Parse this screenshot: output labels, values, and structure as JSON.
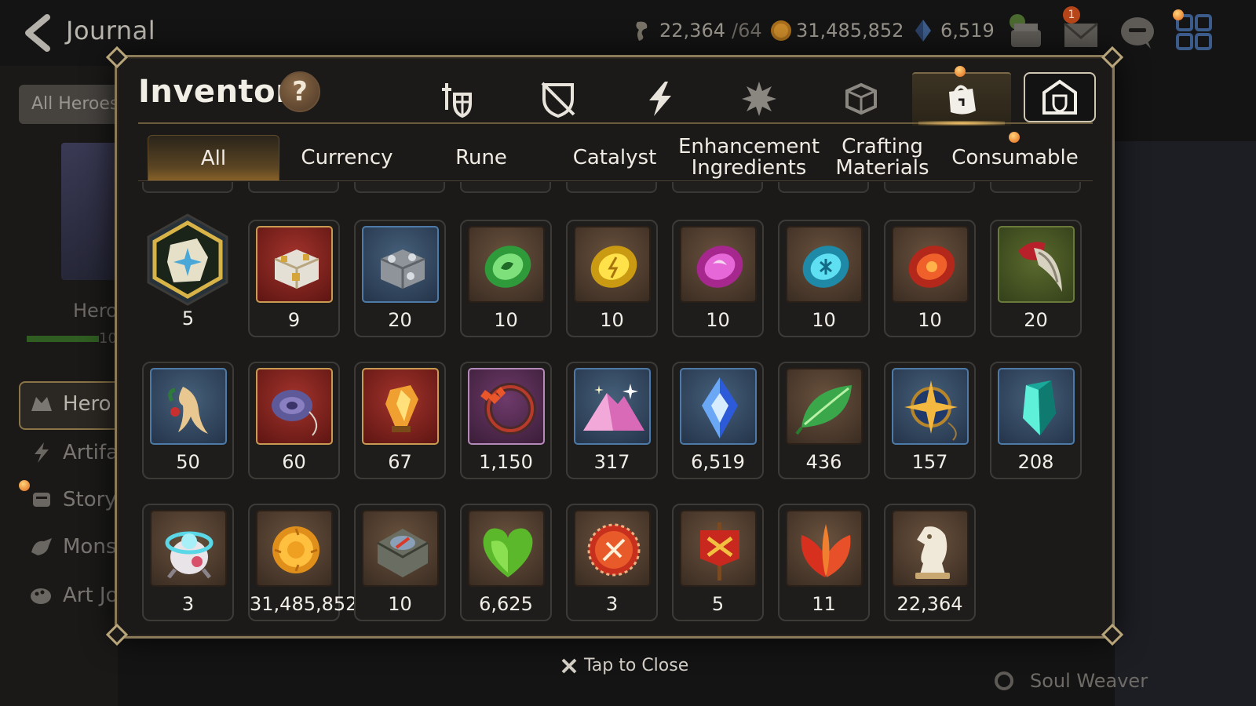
{
  "topbar": {
    "title": "Journal",
    "stamina": "22,364",
    "stamina_max": "/64",
    "gold": "31,485,852",
    "skystone": "6,519",
    "mail_badge": "1"
  },
  "background": {
    "all_heroes": "All Heroes",
    "hero_label": "Hero",
    "hero_bar_value": "10",
    "side_items": [
      "Hero J",
      "Artifa",
      "Story",
      "Mons",
      "Art Jo"
    ],
    "bottom_right_label": "Soul Weaver"
  },
  "inventory": {
    "title": "Inventory",
    "help": "?",
    "category_tabs": [
      "equipment-icon",
      "unequipped-shield-icon",
      "lightning-icon",
      "spirit-icon",
      "material-box-icon",
      "consumable-bag-icon",
      "storage-icon"
    ],
    "subtabs": [
      "All",
      "Currency",
      "Rune",
      "Catalyst",
      "Enhancement Ingredients",
      "Crafting Materials",
      "Consumable"
    ],
    "active_subtab": "All",
    "rows": [
      [
        {
          "icon": "star-shard-hexagon",
          "qty": "5"
        },
        {
          "icon": "gold-chest",
          "qty": "9"
        },
        {
          "icon": "silver-chest",
          "qty": "20"
        },
        {
          "icon": "green-rune",
          "qty": "10"
        },
        {
          "icon": "yellow-rune",
          "qty": "10"
        },
        {
          "icon": "purple-rune",
          "qty": "10"
        },
        {
          "icon": "blue-rune",
          "qty": "10"
        },
        {
          "icon": "red-rune",
          "qty": "10"
        },
        {
          "icon": "demon-claw",
          "qty": "20"
        }
      ],
      [
        {
          "icon": "ginseng-root",
          "qty": "50"
        },
        {
          "icon": "serpent-charm",
          "qty": "60"
        },
        {
          "icon": "flame-crystal",
          "qty": "67"
        },
        {
          "icon": "crimson-flower-ring",
          "qty": "1,150"
        },
        {
          "icon": "stardust-pile",
          "qty": "317"
        },
        {
          "icon": "skystone-crystal",
          "qty": "6,519"
        },
        {
          "icon": "green-leaf",
          "qty": "436"
        },
        {
          "icon": "star-compass",
          "qty": "157"
        },
        {
          "icon": "teal-crystal",
          "qty": "208"
        }
      ],
      [
        {
          "icon": "robot-pet",
          "qty": "3"
        },
        {
          "icon": "gold-coin",
          "qty": "31,485,852"
        },
        {
          "icon": "stone-compass",
          "qty": "10"
        },
        {
          "icon": "green-heart",
          "qty": "6,625"
        },
        {
          "icon": "red-emblem",
          "qty": "3"
        },
        {
          "icon": "battle-banner",
          "qty": "5"
        },
        {
          "icon": "fire-leaf",
          "qty": "11"
        },
        {
          "icon": "chess-knight",
          "qty": "22,364"
        }
      ]
    ]
  },
  "close_hint": "Tap to Close",
  "colors": {
    "gold_accent": "#b9a57a",
    "notification": "#e06418"
  }
}
